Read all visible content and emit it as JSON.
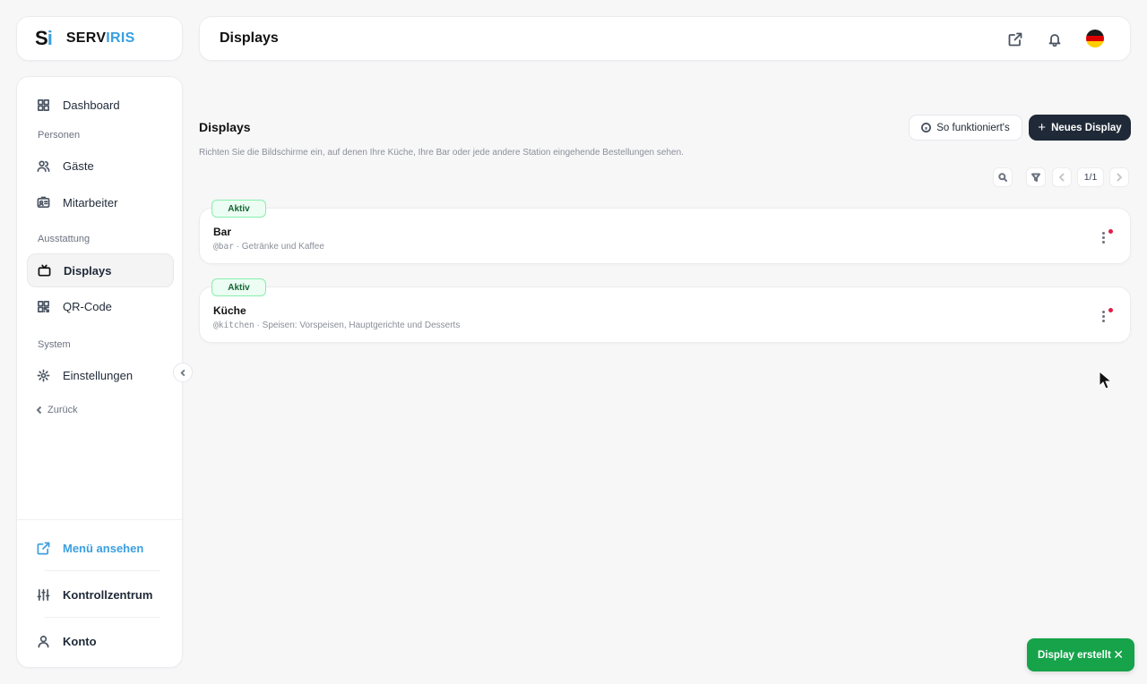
{
  "brand": {
    "mark": "S",
    "mark_accent": "i",
    "name": "SERV",
    "name_accent": "IRIS"
  },
  "header": {
    "title": "Displays",
    "language_flag": "de"
  },
  "sidebar": {
    "dashboard": "Dashboard",
    "section_people": "Personen",
    "guests": "Gäste",
    "staff": "Mitarbeiter",
    "section_equipment": "Ausstattung",
    "displays": "Displays",
    "qr_code": "QR-Code",
    "section_system": "System",
    "settings": "Einstellungen",
    "back": "Zurück",
    "view_menu": "Menü ansehen",
    "control_center": "Kontrollzentrum",
    "account": "Konto"
  },
  "main": {
    "title": "Displays",
    "description": "Richten Sie die Bildschirme ein, auf denen Ihre Küche, Ihre Bar oder jede andere Station eingehende Bestellungen sehen.",
    "how_it_works": "So funktioniert's",
    "new_display": "Neues Display",
    "pagination": "1/1",
    "displays": [
      {
        "status": "Aktiv",
        "name": "Bar",
        "handle": "@bar",
        "description": "Getränke und Kaffee"
      },
      {
        "status": "Aktiv",
        "name": "Küche",
        "handle": "@kitchen",
        "description": "Speisen: Vorspeisen, Hauptgerichte und Desserts"
      }
    ]
  },
  "toast": {
    "message": "Display erstellt",
    "close": "✕"
  },
  "colors": {
    "accent": "#3b9fe0",
    "primary": "#1f2937",
    "success": "#16a34a",
    "badge_bg": "#ecfdf3",
    "notification_dot": "#e11d48"
  }
}
